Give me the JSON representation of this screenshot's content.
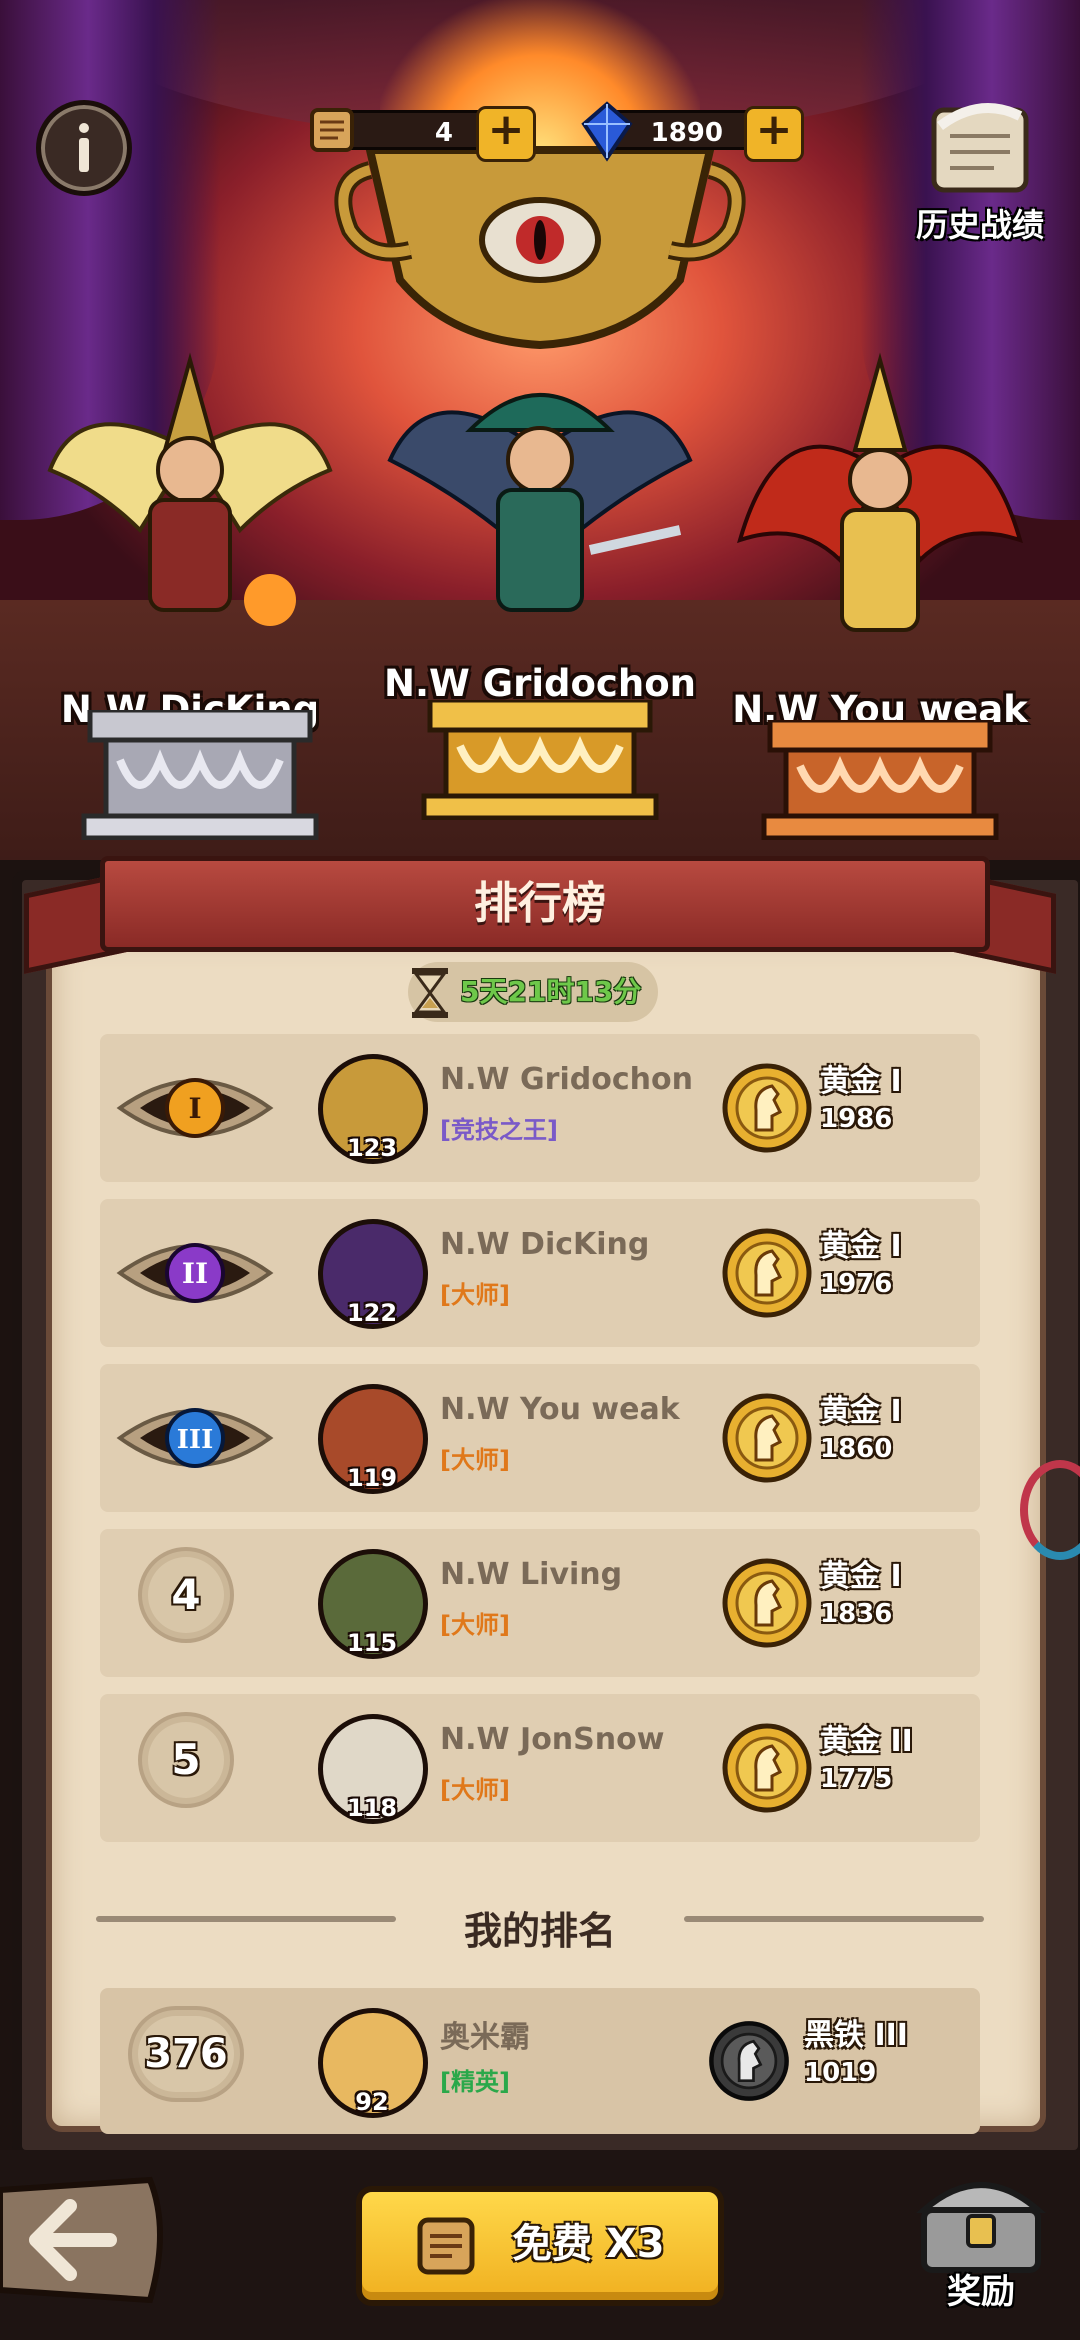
{
  "resources": {
    "scroll_tickets": "4",
    "crystals": "1890",
    "plus": "+"
  },
  "history": {
    "label": "历史战绩"
  },
  "podium": [
    {
      "name": "N.W DicKing",
      "place": 2
    },
    {
      "name": "N.W Gridochon",
      "place": 1
    },
    {
      "name": "N.W You weak",
      "place": 3
    }
  ],
  "leaderboard": {
    "title": "排行榜",
    "timer": "5天21时13分",
    "rows": [
      {
        "rank_label": "I",
        "level": "123",
        "name": "N.W Gridochon",
        "title": "[竞技之王]",
        "title_color": "#7a5ac8",
        "tier": "黄金 I",
        "score": "1986"
      },
      {
        "rank_label": "II",
        "level": "122",
        "name": "N.W DicKing",
        "title": "[大师]",
        "title_color": "#e0781a",
        "tier": "黄金 I",
        "score": "1976"
      },
      {
        "rank_label": "III",
        "level": "119",
        "name": "N.W You weak",
        "title": "[大师]",
        "title_color": "#e0781a",
        "tier": "黄金 I",
        "score": "1860"
      },
      {
        "rank_label": "4",
        "level": "115",
        "name": "N.W Living",
        "title": "[大师]",
        "title_color": "#e0781a",
        "tier": "黄金 I",
        "score": "1836"
      },
      {
        "rank_label": "5",
        "level": "118",
        "name": "N.W JonSnow",
        "title": "[大师]",
        "title_color": "#e0781a",
        "tier": "黄金 II",
        "score": "1775"
      }
    ]
  },
  "my_rank": {
    "heading": "我的排名",
    "rank": "376",
    "level": "92",
    "name": "奥米霸",
    "title": "[精英]",
    "title_color": "#2aa84a",
    "tier": "黑铁 III",
    "score": "1019"
  },
  "bottom": {
    "free_button": "免费 X3",
    "reward_label": "奖励"
  }
}
